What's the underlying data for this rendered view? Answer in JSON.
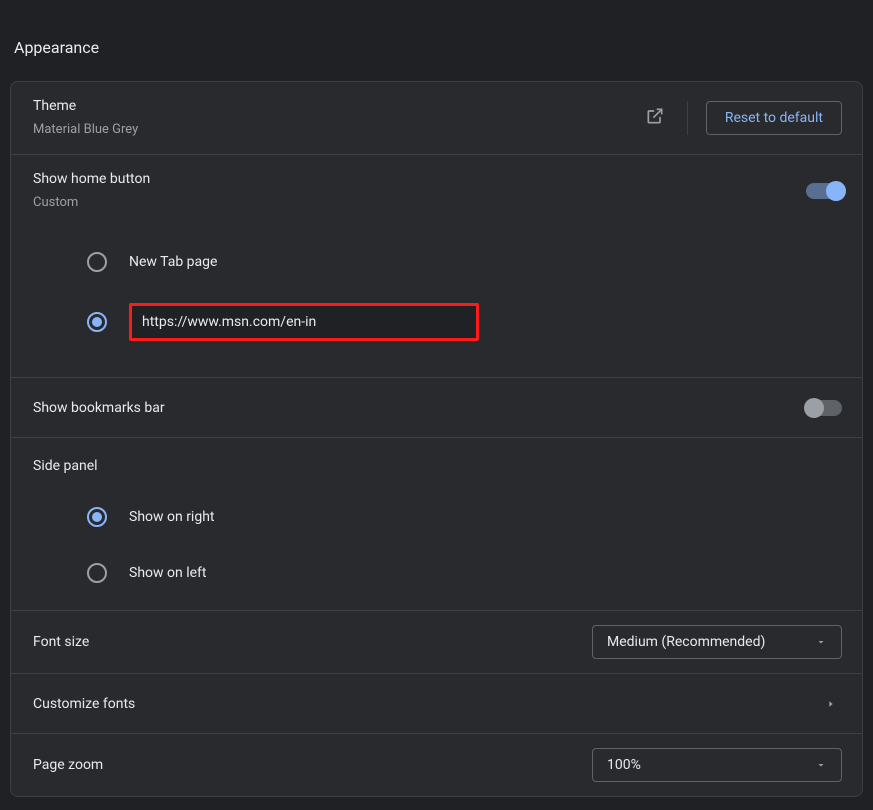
{
  "section": {
    "title": "Appearance"
  },
  "theme": {
    "label": "Theme",
    "value": "Material Blue Grey",
    "reset_button": "Reset to default"
  },
  "home_button": {
    "label": "Show home button",
    "sub": "Custom",
    "enabled": true,
    "options": {
      "new_tab": "New Tab page",
      "custom_url": "https://www.msn.com/en-in",
      "selected": "custom"
    }
  },
  "bookmarks_bar": {
    "label": "Show bookmarks bar",
    "enabled": false
  },
  "side_panel": {
    "label": "Side panel",
    "right": "Show on right",
    "left": "Show on left",
    "selected": "right"
  },
  "font_size": {
    "label": "Font size",
    "value": "Medium (Recommended)"
  },
  "customize_fonts": {
    "label": "Customize fonts"
  },
  "page_zoom": {
    "label": "Page zoom",
    "value": "100%"
  }
}
